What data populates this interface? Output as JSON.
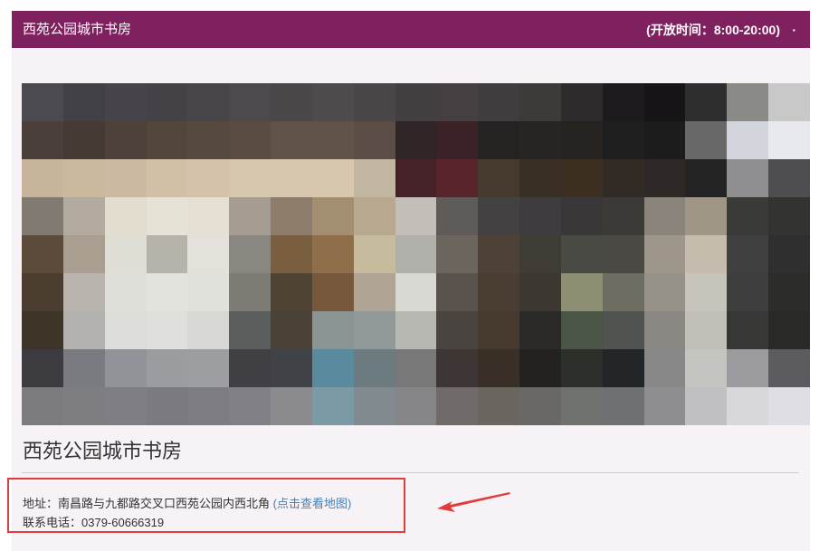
{
  "header": {
    "title": "西苑公园城市书房",
    "hours": "(开放时间：8:00-20:00)",
    "dot": "·"
  },
  "page_title": "西苑公园城市书房",
  "info": {
    "address_label": "地址：",
    "address_value": "南昌路与九都路交叉口西苑公园内西北角",
    "map_link": "(点击查看地图)",
    "phone_label": "联系电话：",
    "phone_value": "0379-60666319"
  },
  "colors": {
    "header_bg": "#80215f",
    "annotation": "#e23b3b",
    "link": "#4a7fb0"
  },
  "photo_pixels": [
    [
      "#4b4a50",
      "#414046",
      "#46444a",
      "#444247",
      "#48454a",
      "#4d4a4d",
      "#4b4749",
      "#4f4a4c",
      "#4a4547",
      "#433f41",
      "#453f41",
      "#413c3d",
      "#3f3a3a",
      "#2e2b2c",
      "#1d1b1d",
      "#161416",
      "#2e2e2e",
      "#8a8a86",
      "#c8c8c8"
    ],
    [
      "#4a3f3b",
      "#463a35",
      "#4e413a",
      "#53463d",
      "#564940",
      "#5a4c43",
      "#605248",
      "#615349",
      "#5b4d45",
      "#2f2426",
      "#3a2226",
      "#262222",
      "#272524",
      "#262321",
      "#1e1e1f",
      "#1c1c1d",
      "#686868",
      "#d3d5dc",
      "#e8e9ee"
    ],
    [
      "#c7b59b",
      "#cbb99e",
      "#cbbaa1",
      "#d1c0a6",
      "#d4c3aa",
      "#d7c7ae",
      "#d6c6ad",
      "#d6c7ae",
      "#c3b7a1",
      "#452227",
      "#5a252a",
      "#453a2d",
      "#3a2f25",
      "#3c2f22",
      "#322a24",
      "#2e2926",
      "#232323",
      "#8f8f92",
      "#4e4e50"
    ],
    [
      "#807a70",
      "#b3aaa0",
      "#e3ddd0",
      "#e7e2d6",
      "#e5e0d3",
      "#a59d92",
      "#8f7d6c",
      "#a48e72",
      "#b8a88f",
      "#c3bfb8",
      "#5e5b59",
      "#444143",
      "#3e3c3f",
      "#393737",
      "#3c3937",
      "#8b847a",
      "#9f9688",
      "#3a3a36",
      "#333331"
    ],
    [
      "#5c4b3a",
      "#a99e90",
      "#deded4",
      "#b6b3ab",
      "#e3e1d9",
      "#8a8680",
      "#7a5e40",
      "#8f6f4a",
      "#c6bc9d",
      "#b0b0ab",
      "#6b655e",
      "#4e4238",
      "#3f3b35",
      "#4a4a44",
      "#4a4944",
      "#9e968a",
      "#c5bcad",
      "#404040",
      "#2f2f2f"
    ],
    [
      "#4b3e31",
      "#b9b5ae",
      "#dfdfd9",
      "#e3e3de",
      "#e1e1dc",
      "#7e7b75",
      "#4f4333",
      "#77583c",
      "#b0a595",
      "#d8d9d2",
      "#5a524c",
      "#4a3d31",
      "#3c3730",
      "#8e8e72",
      "#6e6d61",
      "#969189",
      "#c7c4bc",
      "#3e3e3e",
      "#2c2c2a"
    ],
    [
      "#3f3428",
      "#b3b2ae",
      "#dcdcd8",
      "#dfdfdb",
      "#d7d8d4",
      "#5c5d5d",
      "#4a4236",
      "#8a9493",
      "#909898",
      "#b8b8b3",
      "#4a4440",
      "#463a2e",
      "#2c2a27",
      "#4b5545",
      "#505450",
      "#8b8884",
      "#c1bfb8",
      "#373735",
      "#2a2a28"
    ],
    [
      "#3b3b40",
      "#7a7b80",
      "#919398",
      "#9a9ca0",
      "#9c9ea2",
      "#3f3f44",
      "#3f4246",
      "#5a8a9e",
      "#6c7b80",
      "#787878",
      "#3e3634",
      "#3a2f27",
      "#242220",
      "#2c2f2a",
      "#222629",
      "#888888",
      "#c4c4c0",
      "#9b9ba0",
      "#5c5c60"
    ],
    [
      "#7b7b80",
      "#7d7d82",
      "#7e7e84",
      "#7a7a80",
      "#7c7c82",
      "#808086",
      "#8a8a8f",
      "#7a9aa6",
      "#808a8f",
      "#85858a",
      "#706a68",
      "#6b6560",
      "#6a6866",
      "#707270",
      "#6e7072",
      "#8e8e90",
      "#c0c0c2",
      "#d8d8dc",
      "#dedee4"
    ]
  ]
}
